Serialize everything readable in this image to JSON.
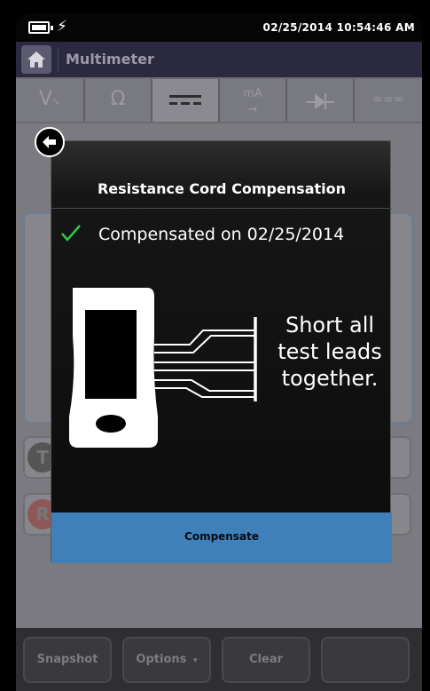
{
  "status_bar": {
    "datetime": "02/25/2014 10:54:46 AM",
    "battery_icon": "battery-charging-icon"
  },
  "header": {
    "title": "Multimeter",
    "home_icon": "home-icon"
  },
  "tabs": [
    {
      "label": "V",
      "icon": "ac-voltage-icon"
    },
    {
      "label": "Ω",
      "icon": "resistance-icon"
    },
    {
      "label": "",
      "icon": "dc-icon",
      "active": true
    },
    {
      "label": "mA",
      "icon": "milliamp-icon"
    },
    {
      "label": "",
      "icon": "diode-icon"
    },
    {
      "label": "",
      "icon": "thermocouple-icon"
    }
  ],
  "dialog": {
    "title": "Resistance Cord Compensation",
    "status": "Compensated on 02/25/2014",
    "instruction": "Short all test leads together.",
    "button_label": "Compensate",
    "colors": {
      "check": "#2ecc40",
      "button": "#3f80bb"
    }
  },
  "background_rows": [
    {
      "badge": "T"
    },
    {
      "badge": "R"
    }
  ],
  "bottom_bar": {
    "snapshot_label": "Snapshot",
    "options_label": "Options",
    "clear_label": "Clear",
    "blank_label": ""
  }
}
